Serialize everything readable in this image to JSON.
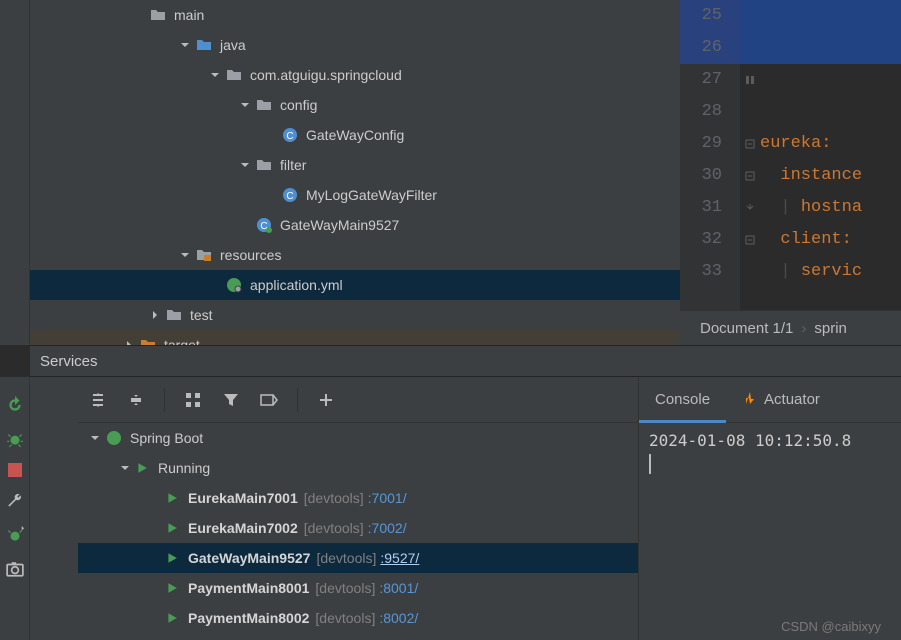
{
  "tree": {
    "main": "main",
    "java": "java",
    "pkg": "com.atguigu.springcloud",
    "config": "config",
    "gateWayConfig": "GateWayConfig",
    "filter": "filter",
    "myLogFilter": "MyLogGateWayFilter",
    "gateWayMain": "GateWayMain9527",
    "resources": "resources",
    "appYml": "application.yml",
    "test": "test",
    "target": "target"
  },
  "editor": {
    "lines": [
      "25",
      "26",
      "27",
      "28",
      "29",
      "30",
      "31",
      "32",
      "33"
    ],
    "code": {
      "l29": "eureka",
      "l30": "instance",
      "l31": "hostna",
      "l32": "client",
      "l33": "servic"
    }
  },
  "crumb": {
    "doc": "Document 1/1",
    "path": "sprin"
  },
  "services": {
    "title": "Services",
    "root": "Spring Boot",
    "running": "Running",
    "devtools": "[devtools]",
    "runs": [
      {
        "name": "EurekaMain7001",
        "port": ":7001/"
      },
      {
        "name": "EurekaMain7002",
        "port": ":7002/"
      },
      {
        "name": "GateWayMain9527",
        "port": ":9527/"
      },
      {
        "name": "PaymentMain8001",
        "port": ":8001/"
      },
      {
        "name": "PaymentMain8002",
        "port": ":8002/"
      }
    ],
    "console": {
      "tabConsole": "Console",
      "tabActuator": "Actuator",
      "log": "2024-01-08 10:12:50.8"
    }
  },
  "watermark": "CSDN @caibixyy"
}
